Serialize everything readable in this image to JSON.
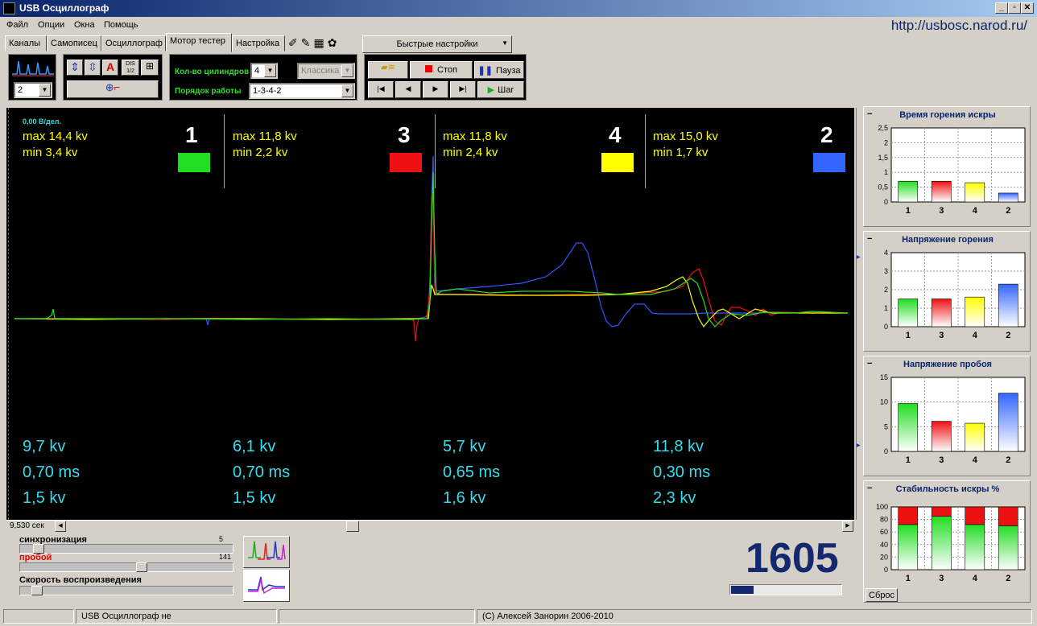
{
  "window": {
    "title": "USB Осциллограф",
    "url": "http://usbosc.narod.ru/"
  },
  "menu": [
    "Файл",
    "Опции",
    "Окна",
    "Помощь"
  ],
  "tabs": [
    "Каналы",
    "Самописец",
    "Осциллограф",
    "Мотор тестер",
    "Настройка"
  ],
  "active_tab": "Мотор тестер",
  "quick_settings": "Быстрые настройки",
  "toolbar": {
    "channel_select": "2",
    "cylinders_label": "Кол-во цилиндров",
    "cylinders_value": "4",
    "mode_value": "Классика",
    "order_label": "Порядок работы",
    "order_value": "1-3-4-2",
    "stop_label": "Стоп",
    "pause_label": "Пауза",
    "step_label": "Шаг",
    "dis_label": "DIS",
    "dis_ratio": "1/2",
    "a_label": "A"
  },
  "scope": {
    "scale_label": "0,00 В/дел.",
    "cylinders": [
      {
        "num": "1",
        "color": "#22dd22",
        "max": "max 14,4 kv",
        "min": "min 3,4 kv",
        "v1": "9,7 kv",
        "t": "0,70 ms",
        "v2": "1,5 kv"
      },
      {
        "num": "3",
        "color": "#ee1111",
        "max": "max 11,8 kv",
        "min": "min 2,2 kv",
        "v1": "6,1 kv",
        "t": "0,70 ms",
        "v2": "1,5 kv"
      },
      {
        "num": "4",
        "color": "#ffff00",
        "max": "max 11,8 kv",
        "min": "min 2,4 kv",
        "v1": "5,7 kv",
        "t": "0,65 ms",
        "v2": "1,6 kv"
      },
      {
        "num": "2",
        "color": "#3366ff",
        "max": "max 15,0 kv",
        "min": "min 1,7 kv",
        "v1": "11,8 kv",
        "t": "0,30 ms",
        "v2": "2,3 kv"
      }
    ],
    "time_label": "9,530 сек"
  },
  "charts_panel": {
    "colors": [
      "#22dd22",
      "#ee1111",
      "#ffff00",
      "#3366ff"
    ],
    "categories": [
      "1",
      "3",
      "4",
      "2"
    ],
    "reset_label": "Сброс"
  },
  "chart_data": [
    {
      "type": "bar",
      "title": "Время горения искры",
      "categories": [
        "1",
        "3",
        "4",
        "2"
      ],
      "values": [
        0.7,
        0.7,
        0.65,
        0.3
      ],
      "ylim": [
        0,
        2.5
      ],
      "yticks": [
        "0",
        "0,5",
        "1",
        "1,5",
        "2",
        "2,5"
      ]
    },
    {
      "type": "bar",
      "title": "Напряжение горения",
      "categories": [
        "1",
        "3",
        "4",
        "2"
      ],
      "values": [
        1.5,
        1.5,
        1.6,
        2.3
      ],
      "ylim": [
        0,
        4
      ],
      "yticks": [
        "0",
        "1",
        "2",
        "3",
        "4"
      ]
    },
    {
      "type": "bar",
      "title": "Напряжение пробоя",
      "categories": [
        "1",
        "3",
        "4",
        "2"
      ],
      "values": [
        9.7,
        6.1,
        5.7,
        11.8
      ],
      "ylim": [
        0,
        15
      ],
      "yticks": [
        "0",
        "5",
        "10",
        "15"
      ]
    },
    {
      "type": "bar",
      "title": "Стабильность искры %",
      "categories": [
        "1",
        "3",
        "4",
        "2"
      ],
      "series": [
        {
          "values": [
            72,
            85,
            72,
            70
          ]
        },
        {
          "values": [
            28,
            15,
            28,
            30
          ]
        }
      ],
      "stacked": true,
      "ylim": [
        0,
        100
      ],
      "yticks": [
        "0",
        "20",
        "40",
        "60",
        "80",
        "100"
      ]
    }
  ],
  "bottom": {
    "sync_label": "синхронизация",
    "sync_value": "5",
    "breakdown_label": "пробой",
    "breakdown_value": "141",
    "speed_label": "Скорость воспроизведения",
    "rpm": "1605"
  },
  "statusbar": [
    "",
    "USB Осциллограф не",
    "",
    "(C) Алексей Занорин 2006-2010"
  ]
}
